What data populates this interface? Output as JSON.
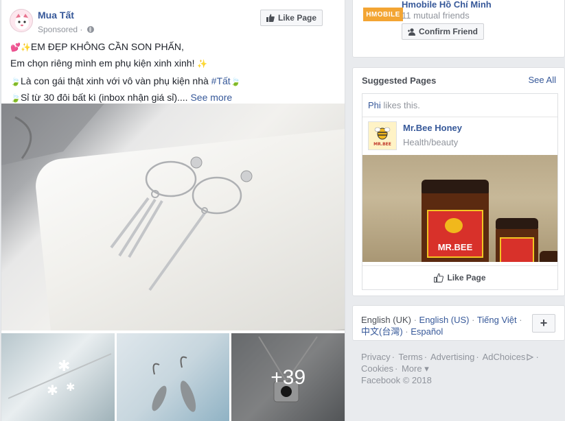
{
  "post": {
    "page_name": "Mua Tất",
    "sponsored": "Sponsored",
    "like_button": "Like Page",
    "text_line1": "EM ĐẸP KHÔNG CẦN SON PHẤN,",
    "text_line2": "Em chọn riêng mình em phụ kiện xinh xinh!",
    "text_line3": "Là con gái thật xinh với vô vàn phụ kiện nhà",
    "hashtag": "#Tất",
    "text_line4": "Sỉ từ 30 đôi bất kì (inbox nhận giá sỉ)....",
    "see_more": "See more",
    "more_photos": "+39"
  },
  "friend_request": {
    "logo_text": "HMOBILE",
    "name": "Hmobile Hồ Chí Minh",
    "mutual": "11 mutual friends",
    "confirm_button": "Confirm Friend"
  },
  "suggested": {
    "title": "Suggested Pages",
    "see_all": "See All",
    "liked_by": "Phi",
    "liked_suffix": " likes this.",
    "page_name": "Mr.Bee Honey",
    "category": "Health/beauty",
    "logo_text": "MR.BEE",
    "photo_label": "MR.BEE",
    "like_button": "Like Page"
  },
  "languages": {
    "current": "English (UK)",
    "items": [
      "English (US)",
      "Tiếng Việt",
      "中文(台灣)",
      "Español"
    ],
    "plus": "+"
  },
  "footer": {
    "links": [
      "Privacy",
      "Terms",
      "Advertising",
      "AdChoices",
      "Cookies",
      "More"
    ],
    "copyright": "Facebook © 2018"
  },
  "colors": {
    "link": "#365899",
    "background": "#e9ebee",
    "muted": "#90949c",
    "hmobile_orange": "#f3a533"
  }
}
